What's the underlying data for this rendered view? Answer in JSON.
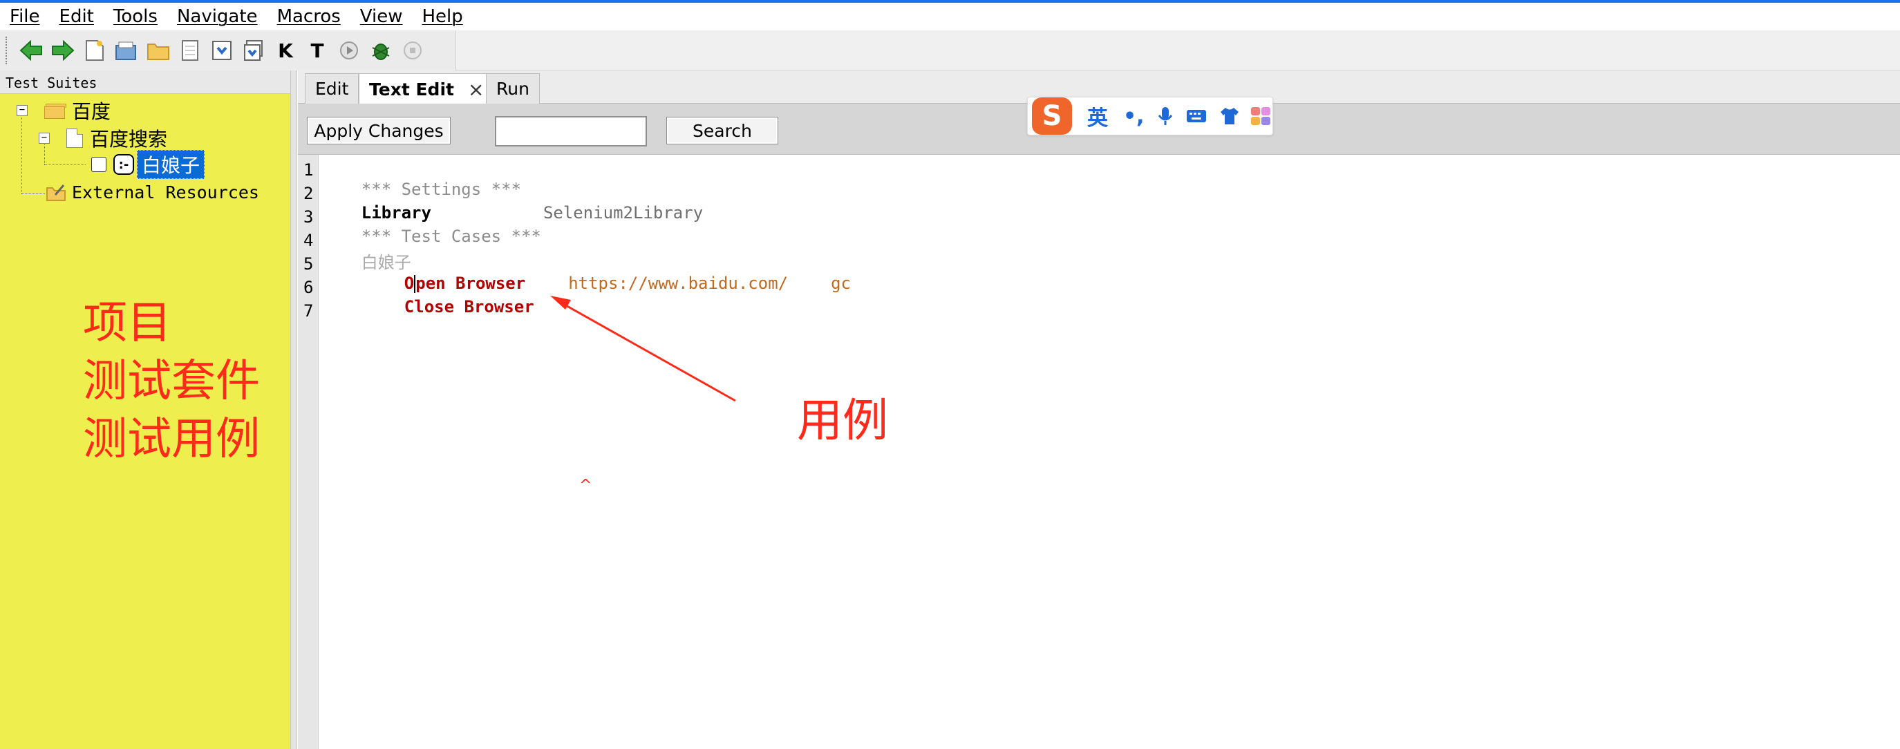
{
  "menu": [
    "File",
    "Edit",
    "Tools",
    "Navigate",
    "Macros",
    "View",
    "Help"
  ],
  "toolbar_icons": [
    "back-icon",
    "forward-icon",
    "new-project-icon",
    "open-icon",
    "open-directory-icon",
    "new-file-icon",
    "save-icon",
    "save-all-icon",
    "keyword-search-icon",
    "test-search-icon",
    "run-icon",
    "debug-icon",
    "stop-icon"
  ],
  "toolbar_glyphs": {
    "keyword_search": "K",
    "test_search": "T"
  },
  "left_panel": {
    "header": "Test Suites",
    "tree": {
      "root": "百度",
      "suite": "百度搜索",
      "test_case": "白娘子",
      "external": "External Resources"
    },
    "annotation": [
      "项目",
      "测试套件",
      "测试用例"
    ]
  },
  "tabs": [
    "Edit",
    "Text Edit",
    "Run"
  ],
  "active_tab": "Text Edit",
  "edit_bar": {
    "apply_label": "Apply Changes",
    "search_value": "",
    "search_label": "Search"
  },
  "ime": {
    "logo": "S",
    "lang": "英",
    "punct": "•,",
    "icons": [
      "microphone-icon",
      "keyboard-icon",
      "shirt-icon",
      "skin-icon"
    ]
  },
  "editor": {
    "line_numbers": [
      "1",
      "2",
      "3",
      "4",
      "5",
      "6",
      "7"
    ],
    "lines": {
      "settings_header": "*** Settings ***",
      "library_keyword": "Library",
      "library_value": "Selenium2Library",
      "test_cases_header": "*** Test Cases ***",
      "test_name": "白娘子",
      "open_kw_first": "O",
      "open_kw_rest": "pen Browser",
      "open_url": "https://www.baidu.com/",
      "open_browser_arg": "gc",
      "close_kw": "Close Browser"
    }
  },
  "annotation_right": "用例",
  "annotation_caret": "^",
  "colors": {
    "left_panel_bg": "#eeee4e",
    "annotation_red": "#ff2a1a",
    "selection_blue": "#0a6bd6",
    "keyword_red": "#b30000",
    "argument_orange": "#c06a20"
  }
}
